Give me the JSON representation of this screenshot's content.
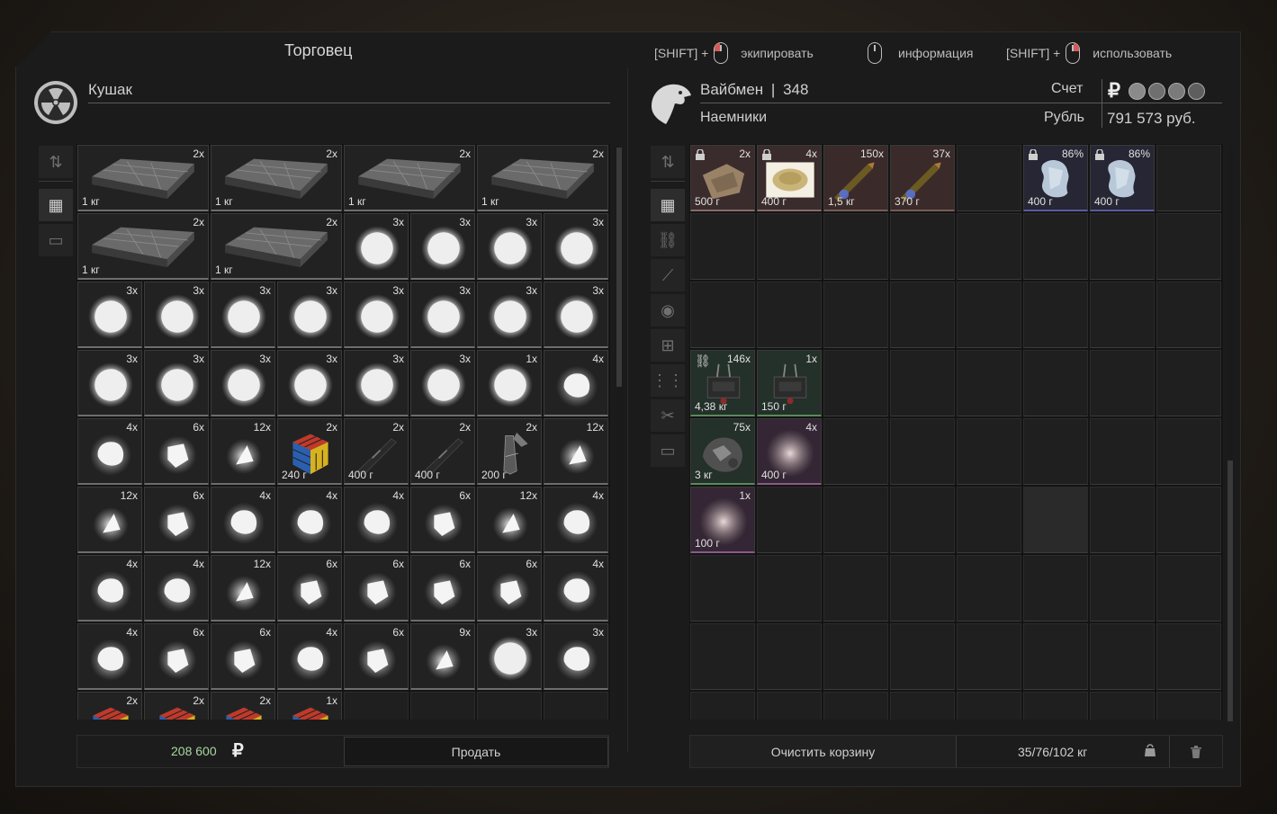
{
  "window": {
    "title": "Торговец",
    "hints": [
      {
        "prefix": "[SHIFT] +",
        "label": "экипировать"
      },
      {
        "prefix": "",
        "label": "информация"
      },
      {
        "prefix": "[SHIFT] +",
        "label": "использовать"
      }
    ]
  },
  "trader": {
    "name": "Кушак"
  },
  "player": {
    "name": "Вайбмен",
    "level_sep": "|",
    "level": "348",
    "faction": "Наемники",
    "account_label": "Счет",
    "currency_label": "Рубль",
    "currency_symbol": "₽",
    "balance": "791 573 руб."
  },
  "colors": {
    "accent_green": "#a8d8a0",
    "mouse_button": "#d45a5a"
  },
  "trader_inventory": {
    "rows": [
      [
        {
          "type": "case",
          "q": "2x",
          "w": "1 кг",
          "span": 2
        },
        {
          "type": "case",
          "q": "2x",
          "w": "1 кг",
          "span": 2
        },
        {
          "type": "case",
          "q": "2x",
          "w": "1 кг",
          "span": 2
        },
        {
          "type": "case",
          "q": "2x",
          "w": "1 кг",
          "span": 2
        }
      ],
      [
        {
          "type": "case",
          "q": "2x",
          "w": "1 кг",
          "span": 2
        },
        {
          "type": "case",
          "q": "2x",
          "w": "1 кг",
          "span": 2
        },
        {
          "type": "ore",
          "q": "3x"
        },
        {
          "type": "ore",
          "q": "3x"
        },
        {
          "type": "ore",
          "q": "3x"
        },
        {
          "type": "ore",
          "q": "3x"
        }
      ],
      [
        {
          "type": "ore",
          "q": "3x"
        },
        {
          "type": "ore",
          "q": "3x"
        },
        {
          "type": "ore",
          "q": "3x"
        },
        {
          "type": "ore",
          "q": "3x"
        },
        {
          "type": "ore",
          "q": "3x"
        },
        {
          "type": "ore",
          "q": "3x"
        },
        {
          "type": "ore",
          "q": "3x"
        },
        {
          "type": "ore",
          "q": "3x"
        }
      ],
      [
        {
          "type": "ore",
          "q": "3x"
        },
        {
          "type": "ore",
          "q": "3x"
        },
        {
          "type": "ore",
          "q": "3x"
        },
        {
          "type": "ore",
          "q": "3x"
        },
        {
          "type": "ore",
          "q": "3x"
        },
        {
          "type": "ore",
          "q": "3x"
        },
        {
          "type": "ore",
          "q": "1x"
        },
        {
          "type": "rock",
          "q": "4x"
        }
      ],
      [
        {
          "type": "rock",
          "q": "4x"
        },
        {
          "type": "chip",
          "q": "6x"
        },
        {
          "type": "shard",
          "q": "12x"
        },
        {
          "type": "cube",
          "q": "2x",
          "w": "240 г"
        },
        {
          "type": "blade",
          "q": "2x",
          "w": "400 г"
        },
        {
          "type": "blade",
          "q": "2x",
          "w": "400 г"
        },
        {
          "type": "tool",
          "q": "2x",
          "w": "200 г"
        },
        {
          "type": "shard",
          "q": "12x"
        }
      ],
      [
        {
          "type": "shard",
          "q": "12x"
        },
        {
          "type": "chip",
          "q": "6x"
        },
        {
          "type": "rock",
          "q": "4x"
        },
        {
          "type": "rock",
          "q": "4x"
        },
        {
          "type": "rock",
          "q": "4x"
        },
        {
          "type": "chip",
          "q": "6x"
        },
        {
          "type": "shard",
          "q": "12x"
        },
        {
          "type": "rock",
          "q": "4x"
        }
      ],
      [
        {
          "type": "rock",
          "q": "4x"
        },
        {
          "type": "rock",
          "q": "4x"
        },
        {
          "type": "shard",
          "q": "12x"
        },
        {
          "type": "chip",
          "q": "6x"
        },
        {
          "type": "chip",
          "q": "6x"
        },
        {
          "type": "chip",
          "q": "6x"
        },
        {
          "type": "chip",
          "q": "6x"
        },
        {
          "type": "rock",
          "q": "4x"
        }
      ],
      [
        {
          "type": "rock",
          "q": "4x"
        },
        {
          "type": "chip",
          "q": "6x"
        },
        {
          "type": "chip",
          "q": "6x"
        },
        {
          "type": "rock",
          "q": "4x"
        },
        {
          "type": "chip",
          "q": "6x"
        },
        {
          "type": "shard",
          "q": "9x"
        },
        {
          "type": "ore",
          "q": "3x"
        },
        {
          "type": "rock",
          "q": "3x"
        }
      ],
      [
        {
          "type": "cube",
          "q": "2x"
        },
        {
          "type": "cube",
          "q": "2x"
        },
        {
          "type": "cube",
          "q": "2x"
        },
        {
          "type": "cube",
          "q": "1x"
        }
      ]
    ]
  },
  "player_inventory": {
    "items": [
      {
        "type": "cloth",
        "q": "2x",
        "w": "500 г",
        "lock": true,
        "row": 0,
        "col": 0
      },
      {
        "type": "powder",
        "q": "4x",
        "w": "400 г",
        "lock": true,
        "row": 0,
        "col": 1
      },
      {
        "type": "bullet",
        "q": "150x",
        "w": "1,5 кг",
        "row": 0,
        "col": 2
      },
      {
        "type": "bullet",
        "q": "37x",
        "w": "370 г",
        "row": 0,
        "col": 3
      },
      {
        "type": "crystal",
        "q": "86%",
        "w": "400 г",
        "lock": true,
        "row": 0,
        "col": 5
      },
      {
        "type": "crystal",
        "q": "86%",
        "w": "400 г",
        "lock": true,
        "row": 0,
        "col": 6
      },
      {
        "type": "device",
        "q": "146x",
        "w": "4,38 кг",
        "link": true,
        "row": 3,
        "col": 0
      },
      {
        "type": "device",
        "q": "1x",
        "w": "150 г",
        "row": 3,
        "col": 1
      },
      {
        "type": "scrap",
        "q": "75x",
        "w": "3 кг",
        "row": 4,
        "col": 0
      },
      {
        "type": "fluff",
        "q": "4x",
        "w": "400 г",
        "row": 4,
        "col": 1
      },
      {
        "type": "fluff",
        "q": "1x",
        "w": "100 г",
        "row": 5,
        "col": 0
      }
    ]
  },
  "footer": {
    "total": "208 600",
    "total_currency": "₽",
    "sell_label": "Продать",
    "clear_label": "Очистить корзину",
    "weight": "35/76/102 кг"
  }
}
